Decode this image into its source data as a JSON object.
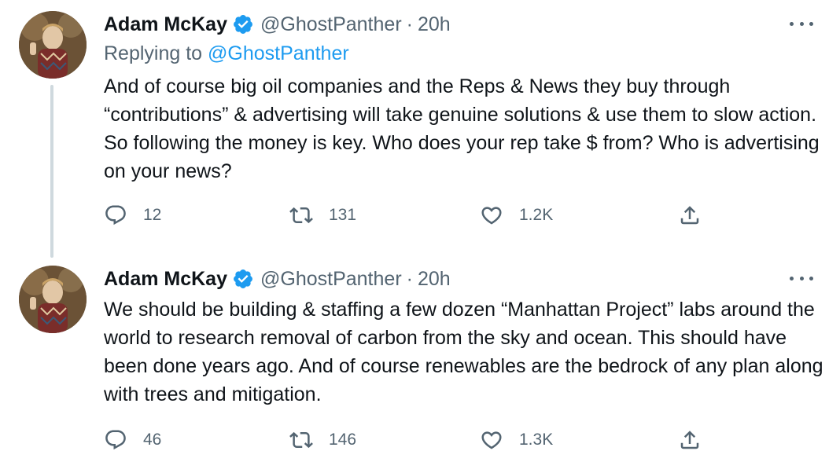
{
  "tweets": [
    {
      "author": {
        "name": "Adam McKay",
        "handle": "@GhostPanther",
        "verified": true
      },
      "separator": "·",
      "time": "20h",
      "replying_label": "Replying to",
      "replying_to": "@GhostPanther",
      "text": "And of course big oil companies and the Reps & News they buy through “contributions” & advertising will take genuine solutions & use them to slow action. So following the money is key. Who does your rep take $ from? Who is advertising on your news?",
      "actions": {
        "replies": "12",
        "retweets": "131",
        "likes": "1.2K"
      }
    },
    {
      "author": {
        "name": "Adam McKay",
        "handle": "@GhostPanther",
        "verified": true
      },
      "separator": "·",
      "time": "20h",
      "text": "We should be building & staffing a few dozen “Manhattan Project” labs around the world to research removal of carbon from the sky and ocean. This should have been done years ago. And of course renewables are the bedrock of any plan along with trees and mitigation.",
      "actions": {
        "replies": "46",
        "retweets": "146",
        "likes": "1.3K"
      }
    }
  ],
  "colors": {
    "accent": "#1d9bf0",
    "muted": "#536471",
    "text": "#0f1419",
    "thread": "#cfd9de"
  },
  "icons": [
    "verified-badge-icon",
    "more-icon",
    "reply-icon",
    "retweet-icon",
    "like-icon",
    "share-icon"
  ]
}
